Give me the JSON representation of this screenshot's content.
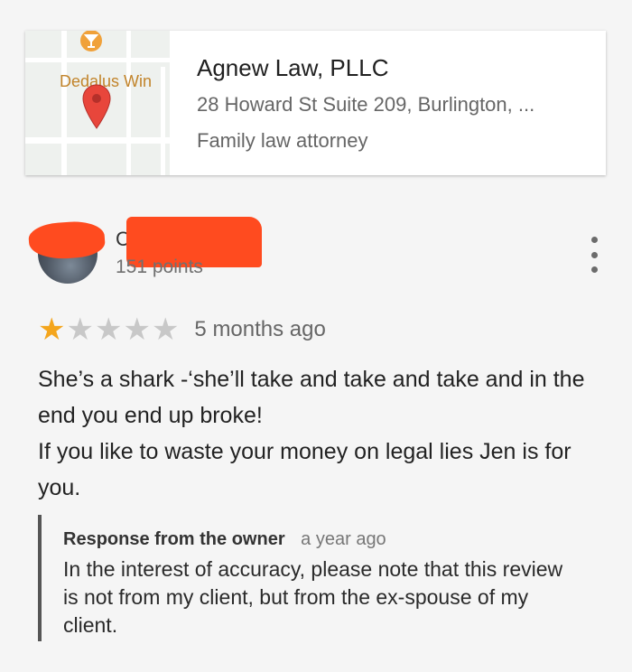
{
  "place": {
    "map_label": "Dedalus Win",
    "name": "Agnew Law, PLLC",
    "address": "28 Howard St Suite 209, Burlington, ...",
    "category": "Family law attorney"
  },
  "reviewer": {
    "initial": "C",
    "points": "151 points"
  },
  "review": {
    "rating": 1,
    "rating_max": 5,
    "time": "5 months ago",
    "text_lines": [
      "She’s a shark -‘she’ll take and take and take and in the end you end up broke!",
      "If you like to waste your money on legal lies Jen is for you."
    ]
  },
  "owner_response": {
    "label": "Response from the owner",
    "time": "a year ago",
    "text": "In the interest of accuracy, please note that this review is not from my client, but from the ex-spouse of my client."
  },
  "colors": {
    "star_filled": "#f4a51c",
    "star_empty": "#c8c8c8",
    "redaction": "#ff4b1f",
    "marker": "#e8463b"
  },
  "icons": [
    "map-marker-icon",
    "poi-glass-icon",
    "more-vert-icon",
    "star-icon"
  ]
}
